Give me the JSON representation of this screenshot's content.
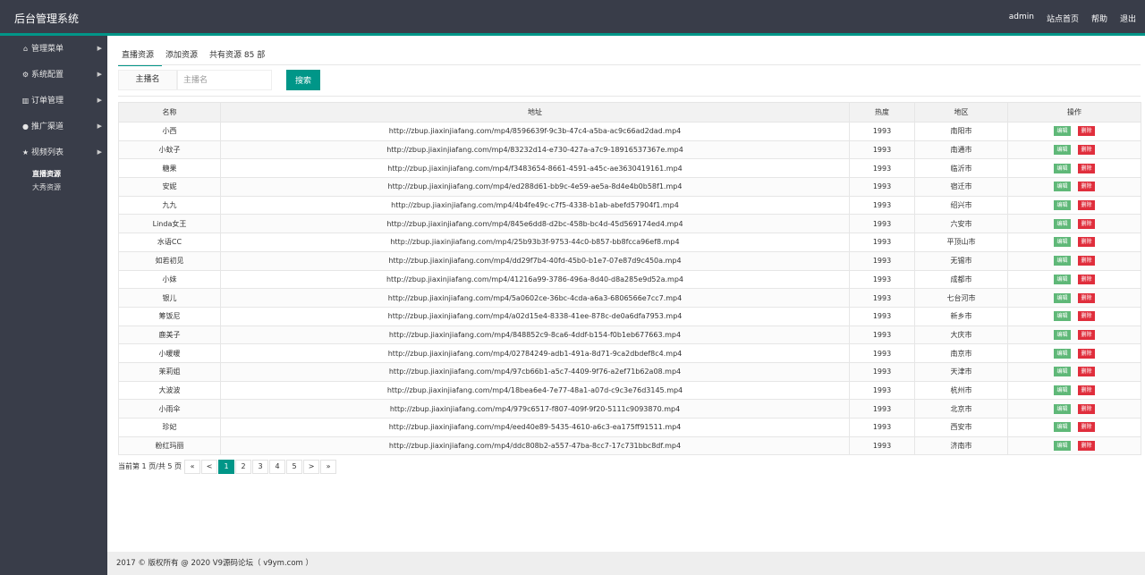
{
  "brand": "后台管理系统",
  "topnav": [
    "admin",
    "站点首页",
    "帮助",
    "退出"
  ],
  "sidebar": {
    "items": [
      {
        "label": "管理菜单",
        "icon": "home-icon",
        "glyph": "⌂"
      },
      {
        "label": "系统配置",
        "icon": "cogs-icon",
        "glyph": "⚙"
      },
      {
        "label": "订单管理",
        "icon": "bar-chart-icon",
        "glyph": "▥"
      },
      {
        "label": "推广渠道",
        "icon": "user-icon",
        "glyph": "●"
      },
      {
        "label": "视频列表",
        "icon": "star-icon",
        "glyph": "★"
      }
    ],
    "subitems": [
      "直播资源",
      "大秀资源"
    ]
  },
  "tabs": [
    "直播资源",
    "添加资源",
    "共有资源 85 部"
  ],
  "search": {
    "label": "主播名",
    "placeholder": "主播名",
    "button": "搜索"
  },
  "table": {
    "headers": [
      "名称",
      "地址",
      "热度",
      "地区",
      "操作"
    ],
    "edit_label": "编辑",
    "delete_label": "删除",
    "rows": [
      [
        "小西",
        "http://zbup.jiaxinjiafang.com/mp4/8596639f-9c3b-47c4-a5ba-ac9c66ad2dad.mp4",
        "1993",
        "南阳市"
      ],
      [
        "小蚊子",
        "http://zbup.jiaxinjiafang.com/mp4/83232d14-e730-427a-a7c9-18916537367e.mp4",
        "1993",
        "南通市"
      ],
      [
        "糖果",
        "http://zbup.jiaxinjiafang.com/mp4/f3483654-8661-4591-a45c-ae3630419161.mp4",
        "1993",
        "临沂市"
      ],
      [
        "安妮",
        "http://zbup.jiaxinjiafang.com/mp4/ed288d61-bb9c-4e59-ae5a-8d4e4b0b58f1.mp4",
        "1993",
        "宿迁市"
      ],
      [
        "九九",
        "http://zbup.jiaxinjiafang.com/mp4/4b4fe49c-c7f5-4338-b1ab-abefd57904f1.mp4",
        "1993",
        "绍兴市"
      ],
      [
        "Linda女王",
        "http://zbup.jiaxinjiafang.com/mp4/845e6dd8-d2bc-458b-bc4d-45d569174ed4.mp4",
        "1993",
        "六安市"
      ],
      [
        "水语CC",
        "http://zbup.jiaxinjiafang.com/mp4/25b93b3f-9753-44c0-b857-bb8fcca96ef8.mp4",
        "1993",
        "平顶山市"
      ],
      [
        "如若初见",
        "http://zbup.jiaxinjiafang.com/mp4/dd29f7b4-40fd-45b0-b1e7-07e87d9c450a.mp4",
        "1993",
        "无锡市"
      ],
      [
        "小妹",
        "http://zbup.jiaxinjiafang.com/mp4/41216a99-3786-496a-8d40-d8a285e9d52a.mp4",
        "1993",
        "成都市"
      ],
      [
        "银儿",
        "http://zbup.jiaxinjiafang.com/mp4/5a0602ce-36bc-4cda-a6a3-6806566e7cc7.mp4",
        "1993",
        "七台河市"
      ],
      [
        "筹饭尼",
        "http://zbup.jiaxinjiafang.com/mp4/a02d15e4-8338-41ee-878c-de0a6dfa7953.mp4",
        "1993",
        "新乡市"
      ],
      [
        "鹿美子",
        "http://zbup.jiaxinjiafang.com/mp4/848852c9-8ca6-4ddf-b154-f0b1eb677663.mp4",
        "1993",
        "大庆市"
      ],
      [
        "小暖暖",
        "http://zbup.jiaxinjiafang.com/mp4/02784249-adb1-491a-8d71-9ca2dbdef8c4.mp4",
        "1993",
        "南京市"
      ],
      [
        "茉莉姐",
        "http://zbup.jiaxinjiafang.com/mp4/97cb66b1-a5c7-4409-9f76-a2ef71b62a08.mp4",
        "1993",
        "天津市"
      ],
      [
        "大波波",
        "http://zbup.jiaxinjiafang.com/mp4/18bea6e4-7e77-48a1-a07d-c9c3e76d3145.mp4",
        "1993",
        "杭州市"
      ],
      [
        "小雨伞",
        "http://zbup.jiaxinjiafang.com/mp4/979c6517-f807-409f-9f20-5111c9093870.mp4",
        "1993",
        "北京市"
      ],
      [
        "珍妃",
        "http://zbup.jiaxinjiafang.com/mp4/eed40e89-5435-4610-a6c3-ea175ff91511.mp4",
        "1993",
        "西安市"
      ],
      [
        "粉红玛丽",
        "http://zbup.jiaxinjiafang.com/mp4/ddc808b2-a557-47ba-8cc7-17c731bbc8df.mp4",
        "1993",
        "济南市"
      ]
    ]
  },
  "pager": {
    "info": "当前第 1 页/共 5 页",
    "buttons": [
      "«",
      "<",
      "1",
      "2",
      "3",
      "4",
      "5",
      ">",
      "»"
    ],
    "current": "1"
  },
  "footer": "2017 © 版权所有 @ 2020 V9源码论坛（ v9ym.com ）",
  "colors": {
    "accent": "#009688",
    "dark": "#393d49",
    "edit": "#5fb878",
    "delete": "#e02e3c"
  }
}
